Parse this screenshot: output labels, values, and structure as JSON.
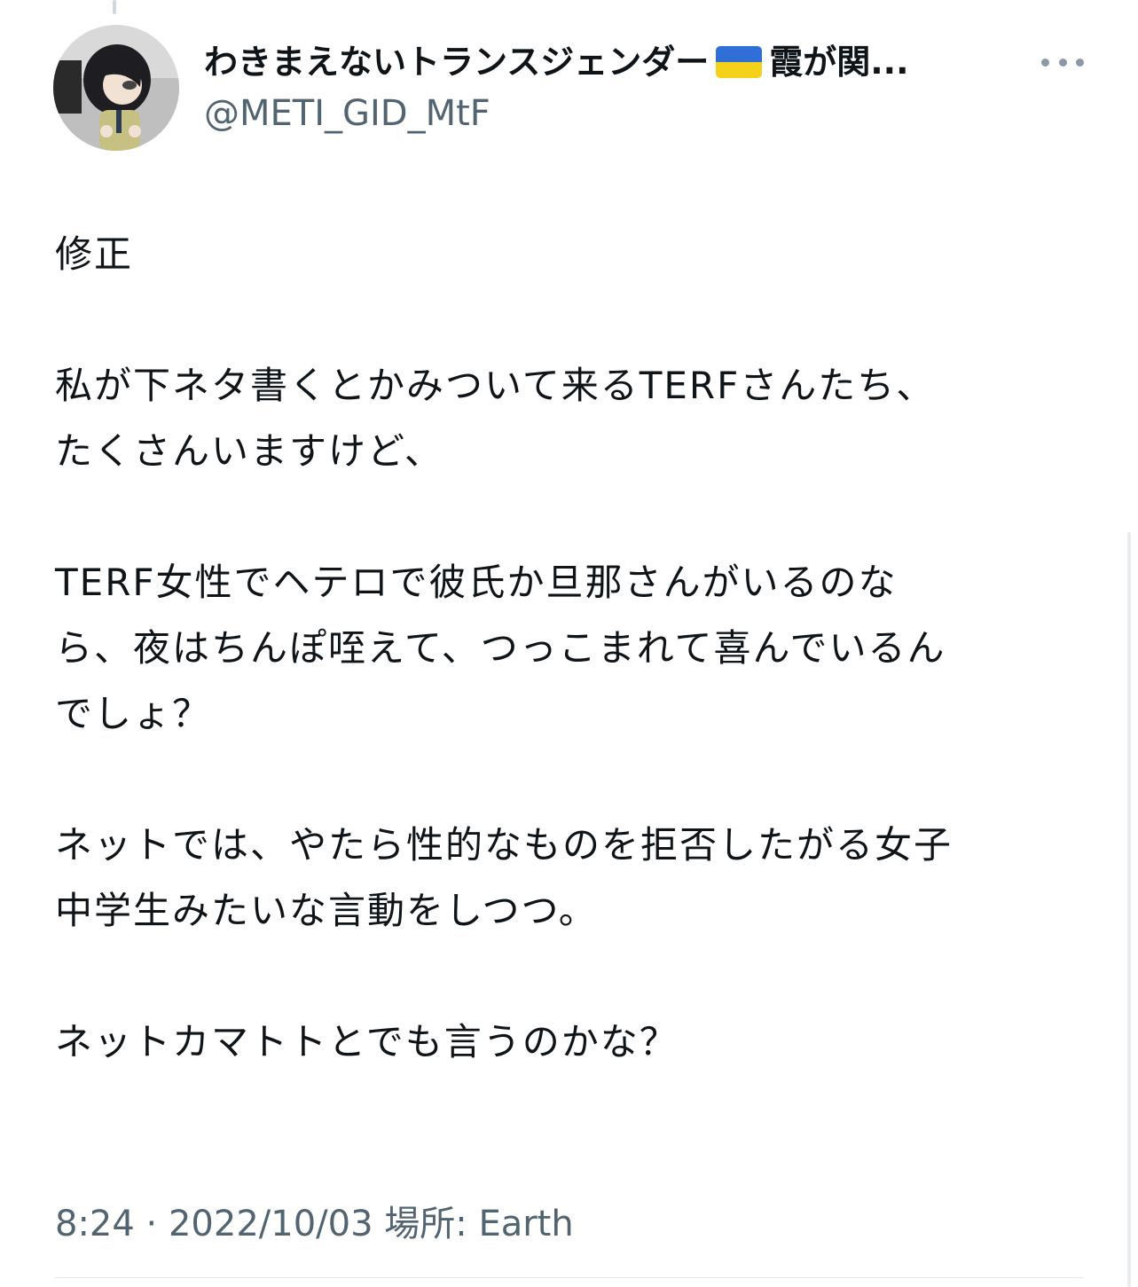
{
  "author": {
    "display_name_before_flag": "わきまえないトランスジェンダー",
    "display_name_after_flag": "霞が関...",
    "handle": "@METI_GID_MtF",
    "flag_icon": "ukraine-flag-icon",
    "avatar_icon": "figurine-avatar"
  },
  "more_icon": "more-dots-icon",
  "tweet": {
    "lines": [
      "修正",
      "",
      "私が下ネタ書くとかみついて来るTERFさんたち、",
      "たくさんいますけど、",
      "",
      "TERF女性でヘテロで彼氏か旦那さんがいるのな",
      "ら、夜はちんぽ咥えて、つっこまれて喜んでいるん",
      "でしょ？",
      "",
      "ネットでは、やたら性的なものを拒否したがる女子",
      "中学生みたいな言動をしつつ。",
      "",
      "ネットカマトトとでも言うのかな？"
    ]
  },
  "meta": {
    "time": "8:24",
    "separator": "·",
    "date": "2022/10/03",
    "location_label": "場所:",
    "location": "Earth"
  },
  "colors": {
    "text": "#0f1419",
    "secondary": "#536471",
    "divider": "#e1e8ed",
    "flag_blue": "#2f6fd6",
    "flag_yellow": "#f4d21a"
  }
}
